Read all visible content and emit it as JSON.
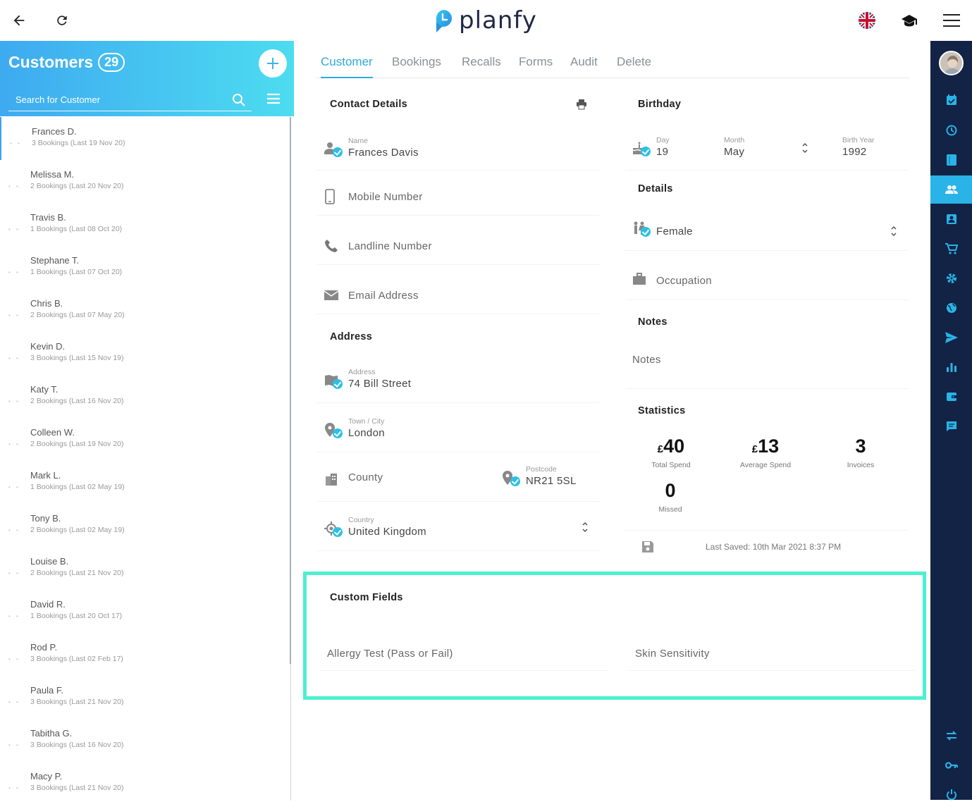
{
  "app": {
    "name": "planfy"
  },
  "colors": {
    "accent": "#2eaadc",
    "nav_bg": "#122345",
    "highlight": "#4df0d0"
  },
  "topbar": {
    "back_icon": "arrow-left-icon",
    "reload_icon": "reload-icon",
    "flag_icon": "uk-flag-icon",
    "academy_icon": "graduation-cap-icon",
    "menu_icon": "hamburger-menu-icon"
  },
  "customers": {
    "title": "Customers",
    "count": "29",
    "search_placeholder": "Search for Customer",
    "items": [
      {
        "name": "Frances D.",
        "sub": "3 Bookings (Last 19 Nov 20)"
      },
      {
        "name": "Melissa M.",
        "sub": "2 Bookings (Last 20 Nov 20)"
      },
      {
        "name": "Travis B.",
        "sub": "1 Bookings (Last 08 Oct 20)"
      },
      {
        "name": "Stephane T.",
        "sub": "1 Bookings (Last 07 Oct 20)"
      },
      {
        "name": "Chris B.",
        "sub": "2 Bookings (Last 07 May 20)"
      },
      {
        "name": "Kevin D.",
        "sub": "3 Bookings (Last 15 Nov 19)"
      },
      {
        "name": "Katy T.",
        "sub": "2 Bookings (Last 16 Nov 20)"
      },
      {
        "name": "Colleen W.",
        "sub": "2 Bookings (Last 19 Nov 20)"
      },
      {
        "name": "Mark L.",
        "sub": "1 Bookings (Last 02 May 19)"
      },
      {
        "name": "Tony B.",
        "sub": "2 Bookings (Last 02 May 19)"
      },
      {
        "name": "Louise B.",
        "sub": "2 Bookings (Last 21 Nov 20)"
      },
      {
        "name": "David R.",
        "sub": "1 Bookings (Last 20 Oct 17)"
      },
      {
        "name": "Rod P.",
        "sub": "3 Bookings (Last 02 Feb 17)"
      },
      {
        "name": "Paula F.",
        "sub": "3 Bookings (Last 21 Nov 20)"
      },
      {
        "name": "Tabitha G.",
        "sub": "3 Bookings (Last 16 Nov 20)"
      },
      {
        "name": "Macy P.",
        "sub": "3 Bookings (Last 21 Nov 20)"
      }
    ]
  },
  "tabs": [
    "Customer",
    "Bookings",
    "Recalls",
    "Forms",
    "Audit",
    "Delete"
  ],
  "contact": {
    "title": "Contact Details",
    "name_label": "Name",
    "name_value": "Frances Davis",
    "mobile_placeholder": "Mobile Number",
    "landline_placeholder": "Landline Number",
    "email_placeholder": "Email Address"
  },
  "address": {
    "title": "Address",
    "address_label": "Address",
    "address_value": "74 Bill Street",
    "town_label": "Town / City",
    "town_value": "London",
    "county_placeholder": "County",
    "postcode_label": "Postcode",
    "postcode_value": "NR21 5SL",
    "country_label": "Country",
    "country_value": "United Kingdom"
  },
  "birthday": {
    "title": "Birthday",
    "day_label": "Day",
    "day_value": "19",
    "month_label": "Month",
    "month_value": "May",
    "year_label": "Birth Year",
    "year_value": "1992"
  },
  "details": {
    "title": "Details",
    "gender_value": "Female",
    "occupation_placeholder": "Occupation"
  },
  "notes": {
    "title": "Notes",
    "placeholder": "Notes"
  },
  "statistics": {
    "title": "Statistics",
    "currency": "£",
    "total_spend": "40",
    "total_spend_label": "Total Spend",
    "average_spend": "13",
    "average_spend_label": "Average Spend",
    "invoices": "3",
    "invoices_label": "Invoices",
    "missed": "0",
    "missed_label": "Missed"
  },
  "last_saved": "Last Saved: 10th Mar 2021 8:37 PM",
  "custom_fields": {
    "title": "Custom Fields",
    "field1_placeholder": "Allergy Test (Pass or Fail)",
    "field2_placeholder": "Skin Sensitivity"
  },
  "right_nav": [
    "calendar-check-icon",
    "clock-icon",
    "book-icon",
    "customers-icon",
    "staff-icon",
    "cart-icon",
    "settings-icon",
    "globe-icon",
    "send-icon",
    "reports-icon",
    "wallet-icon",
    "chat-icon",
    "switch-icon",
    "key-icon",
    "power-icon"
  ]
}
